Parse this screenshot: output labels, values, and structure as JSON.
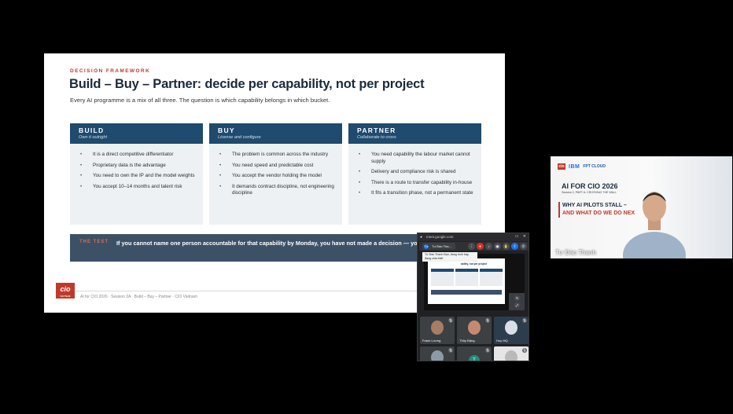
{
  "slide": {
    "kicker": "DECISION FRAMEWORK",
    "title": "Build – Buy – Partner: decide per capability, not per project",
    "subtitle": "Every AI programme is a mix of all three. The question is which capability belongs in which bucket.",
    "columns": [
      {
        "name": "BUILD",
        "tagline": "Own it outright",
        "items": [
          "It is a direct competitive differentiator",
          "Proprietary data is the advantage",
          "You need to own the IP and the model weights",
          "You accept 10–14 months and talent risk"
        ]
      },
      {
        "name": "BUY",
        "tagline": "License and configure",
        "items": [
          "The problem is common across the industry",
          "You need speed and predictable cost",
          "You accept the vendor holding the model",
          "It demands contract discipline, not engineering discipline"
        ]
      },
      {
        "name": "PARTNER",
        "tagline": "Collaborate to cross",
        "items": [
          "You need capability the labour market cannot supply",
          "Delivery and compliance risk is shared",
          "There is a route to transfer capability in-house",
          "It fits a transition phase, not a permanent state"
        ]
      }
    ],
    "callout": {
      "tag": "THE TEST",
      "text": "If you cannot name one person accountable for that capability by Monday, you have not made a decision — yo purchase."
    },
    "logo_text": "cio",
    "logo_sub": "VIETNAM",
    "footer": "AI for CIO 2026 · Session 2A · Build – Buy – Partner · CIO Vietnam"
  },
  "speaker": {
    "logo_cio": "cio",
    "logo_ibm": "IBM",
    "logo_fpt": "FPT CLOUD",
    "event_title": "AI FOR CIO 2026",
    "session_line": "Session 2, PART A: CROSSING THE WALL",
    "headline_1": "WHY AI PILOTS STALL –",
    "headline_2": "AND WHAT DO WE DO NEX",
    "name": "Tư Đào Thanh"
  },
  "meet": {
    "url": "meet.google.com",
    "presenter_chip": "Tư Đào Tha...",
    "presenter_initial": "Tư",
    "tooltip": "Tư Đào Thanh Bạn, đang trình bày, đang chia thiết",
    "mini_slide_title": "ability, not per project",
    "participants": [
      {
        "name": "Frank Lương",
        "initial": ""
      },
      {
        "name": "Thủy Đặng",
        "initial": ""
      },
      {
        "name": "Huy MQ",
        "initial": ""
      },
      {
        "name": "",
        "initial": ""
      },
      {
        "name": "",
        "initial": "T"
      },
      {
        "name": "",
        "initial": ""
      }
    ]
  },
  "colors": {
    "accent_red": "#c0392b",
    "column_header": "#1e4b6e",
    "callout_bg": "#3c5166",
    "meet_bg": "#202124"
  }
}
